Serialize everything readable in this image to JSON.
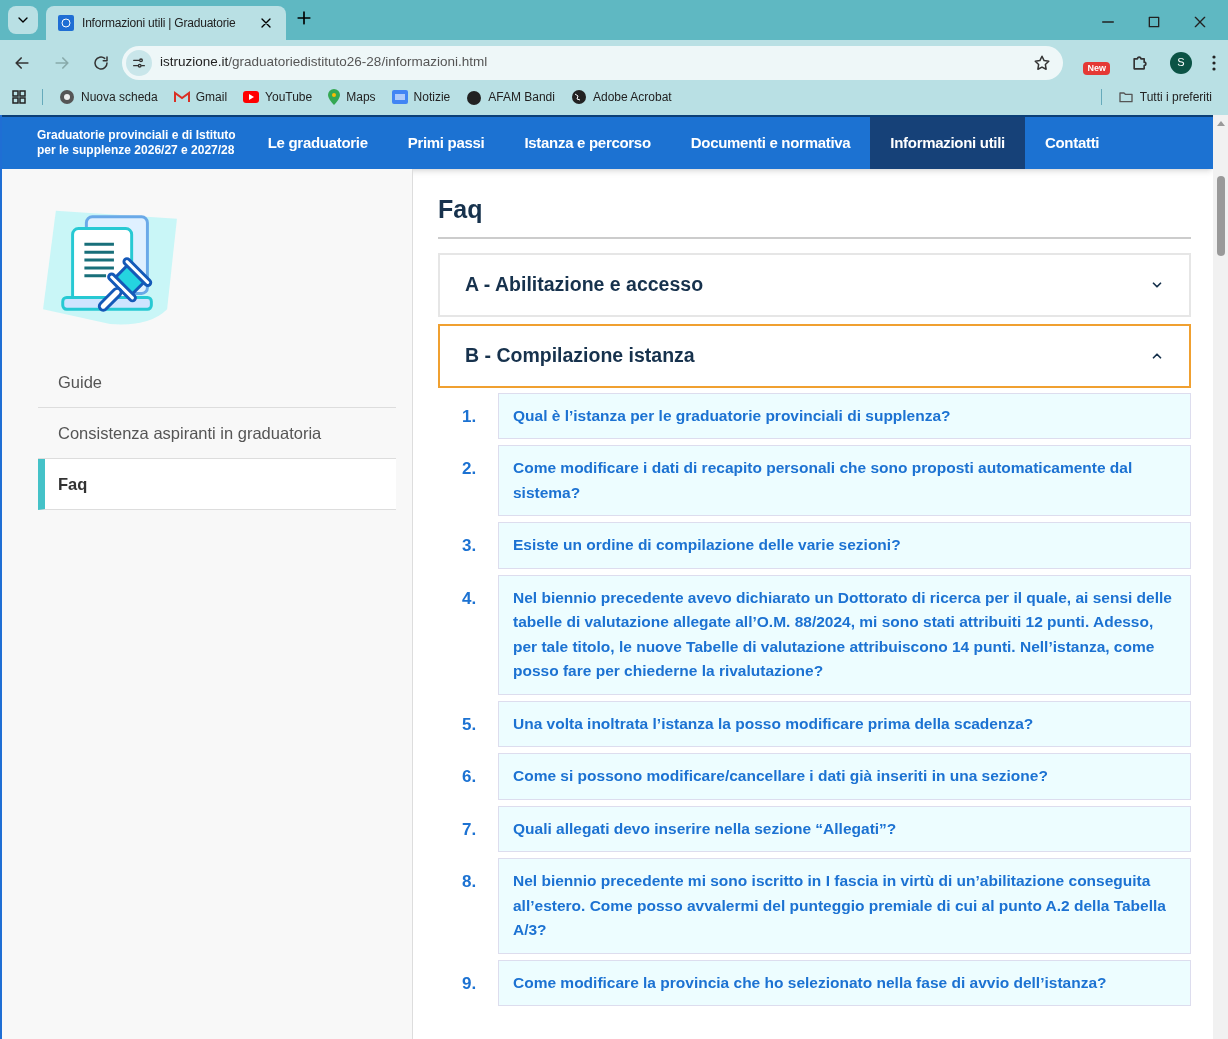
{
  "browser": {
    "tabs": [
      {
        "title": "Informazioni utili | Graduatorie",
        "selected": true
      }
    ],
    "url": {
      "host": "istruzione.it",
      "path": "/graduatoriedistituto26-28/informazioni.html"
    },
    "extension_badge": "New",
    "profile": "S",
    "bookmarks": [
      {
        "label": "Nuova scheda"
      },
      {
        "label": "Gmail"
      },
      {
        "label": "YouTube"
      },
      {
        "label": "Maps"
      },
      {
        "label": "Notizie"
      },
      {
        "label": "AFAM Bandi"
      },
      {
        "label": "Adobe Acrobat"
      }
    ],
    "all_bookmarks": "Tutti i preferiti"
  },
  "site": {
    "brand": [
      "Graduatorie provinciali e di Istituto",
      "per le supplenze 2026/27 e 2027/28"
    ],
    "nav": [
      {
        "label": "Le graduatorie",
        "selected": false
      },
      {
        "label": "Primi passi",
        "selected": false
      },
      {
        "label": "Istanza e percorso",
        "selected": false
      },
      {
        "label": "Documenti e normativa",
        "selected": false
      },
      {
        "label": "Informazioni utili",
        "selected": true
      },
      {
        "label": "Contatti",
        "selected": false
      }
    ],
    "sidebar": [
      {
        "label": "Guide",
        "selected": false
      },
      {
        "label": "Consistenza aspiranti in graduatoria",
        "selected": false
      },
      {
        "label": "Faq",
        "selected": true
      }
    ],
    "heading": "Faq",
    "sections": [
      {
        "label": "A - Abilitazione e accesso",
        "expanded": false
      },
      {
        "label": "B - Compilazione istanza",
        "expanded": true
      }
    ],
    "questions": [
      {
        "number": "1.",
        "text": "Qual è l’istanza per le graduatorie provinciali di supplenza?"
      },
      {
        "number": "2.",
        "text": "Come modificare i dati di recapito personali che sono proposti automaticamente dal sistema?"
      },
      {
        "number": "3.",
        "text": "Esiste un ordine di compilazione delle varie sezioni?"
      },
      {
        "number": "4.",
        "text": "Nel biennio precedente avevo dichiarato un Dottorato di ricerca per il quale, ai sensi delle tabelle di valutazione allegate all’O.M. 88/2024, mi sono stati attribuiti 12 punti. Adesso, per tale titolo, le nuove Tabelle di valutazione attribuiscono 14 punti. Nell’istanza, come posso fare per chiederne la rivalutazione?"
      },
      {
        "number": "5.",
        "text": "Una volta inoltrata l’istanza la posso modificare prima della scadenza?"
      },
      {
        "number": "6.",
        "text": "Come si possono modificare/cancellare i dati già inseriti in una sezione?"
      },
      {
        "number": "7.",
        "text": "Quali allegati devo inserire nella sezione “Allegati”?"
      },
      {
        "number": "8.",
        "text": "Nel biennio precedente mi sono iscritto in I fascia in virtù di un’abilitazione conseguita all’estero. Come posso avvalermi del punteggio premiale di cui al punto A.2 della Tabella A/3?"
      },
      {
        "number": "9.",
        "text": "Come modificare la provincia che ho selezionato nella fase di avvio dell’istanza?"
      }
    ]
  }
}
